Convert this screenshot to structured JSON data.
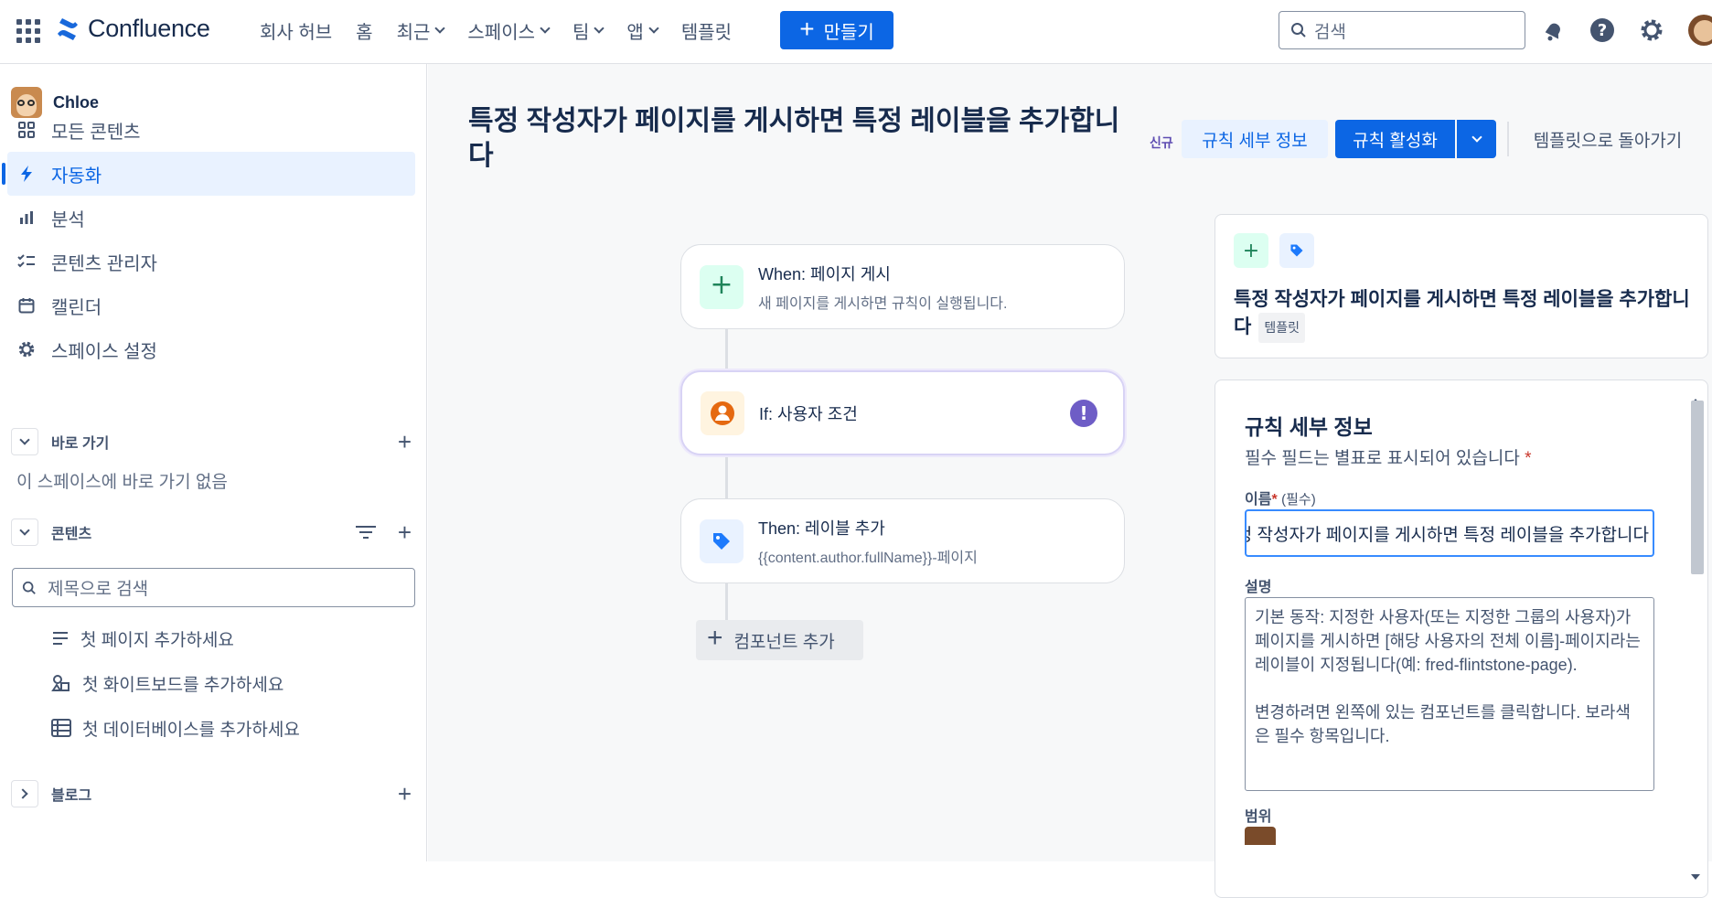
{
  "app": {
    "name": "Confluence"
  },
  "nav": {
    "items": [
      {
        "label": "회사 허브",
        "dropdown": false
      },
      {
        "label": "홈",
        "dropdown": false
      },
      {
        "label": "최근",
        "dropdown": true
      },
      {
        "label": "스페이스",
        "dropdown": true
      },
      {
        "label": "팀",
        "dropdown": true
      },
      {
        "label": "앱",
        "dropdown": true
      },
      {
        "label": "템플릿",
        "dropdown": false
      }
    ],
    "create_label": "만들기",
    "search_placeholder": "검색"
  },
  "sidebar": {
    "space_name": "Chloe",
    "items": [
      {
        "label": "모든 콘텐츠",
        "icon": "grid-icon"
      },
      {
        "label": "자동화",
        "icon": "lightning-icon",
        "active": true
      },
      {
        "label": "분석",
        "icon": "bar-chart-icon"
      },
      {
        "label": "콘텐츠 관리자",
        "icon": "checklist-icon"
      },
      {
        "label": "캘린더",
        "icon": "calendar-icon"
      },
      {
        "label": "스페이스 설정",
        "icon": "gear-icon"
      }
    ],
    "shortcuts": {
      "label": "바로 가기",
      "empty_text": "이 스페이스에 바로 가기 없음"
    },
    "content": {
      "label": "콘텐츠",
      "search_placeholder": "제목으로 검색",
      "items": [
        {
          "label": "첫 페이지 추가하세요",
          "icon": "page-icon"
        },
        {
          "label": "첫 화이트보드를 추가하세요",
          "icon": "whiteboard-icon"
        },
        {
          "label": "첫 데이터베이스를 추가하세요",
          "icon": "database-icon"
        }
      ]
    },
    "blog": {
      "label": "블로그"
    }
  },
  "page": {
    "title": "특정 작성자가 페이지를 게시하면 특정 레이블을 추가합니다",
    "new_badge": "신규",
    "rule_details_button": "규칙 세부 정보",
    "activate_button": "규칙 활성화",
    "back_button": "템플릿으로 돌아가기"
  },
  "flow": {
    "when": {
      "prefix": "When: ",
      "title": "페이지 게시",
      "sub": "새 페이지를 게시하면 규칙이 실행됩니다."
    },
    "if": {
      "prefix": "If: ",
      "title": "사용자 조건",
      "warning": "!"
    },
    "then": {
      "prefix": "Then: ",
      "title": "레이블 추가",
      "sub": "{{content.author.fullName}}-페이지"
    },
    "add_component": "컴포넌트 추가"
  },
  "template_card": {
    "title": "특정 작성자가 페이지를 게시하면 특정 레이블을 추가합니다",
    "tag": "템플릿"
  },
  "details": {
    "title": "규칙 세부 정보",
    "required_note": "필수 필드는 별표로 표시되어 있습니다",
    "name_label": "이름",
    "name_required": "(필수)",
    "name_value": "특정 작성자가 페이지를 게시하면 특정 레이블을 추가합니다",
    "desc_label": "설명",
    "desc_value": "기본 동작: 지정한 사용자(또는 지정한 그룹의 사용자)가 페이지를 게시하면 [해당 사용자의 전체 이름]-페이지라는 레이블이 지정됩니다(예: fred-flintstone-page).\n\n변경하려면 왼쪽에 있는 컴포넌트를 클릭합니다. 보라색은 필수 항목입니다.",
    "scope_label": "범위"
  },
  "colors": {
    "accent": "#0c66e4",
    "active_bg": "#e9f2ff",
    "warning": "#6e5dc6"
  }
}
